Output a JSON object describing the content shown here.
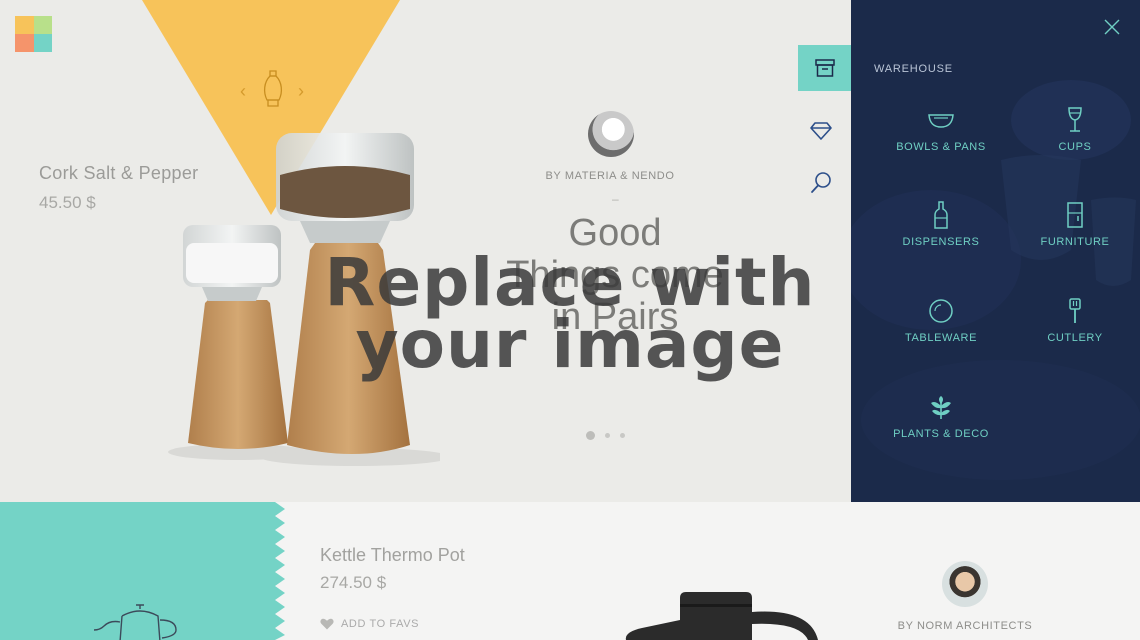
{
  "colors": {
    "hero_bg": "#ebebe8",
    "triangle": "#f7c35a",
    "teal": "#74d3c6",
    "panel": "#1b2a4a",
    "panel_label": "#6fcfc3",
    "logo": [
      "#f7c35a",
      "#b8e08a",
      "#f5946b",
      "#74d3c6"
    ]
  },
  "hero": {
    "product_name": "Cork Salt & Pepper",
    "product_price": "45.50 $",
    "byline": "BY MATERIA & NENDO",
    "dash": "–",
    "headline_line1": "Good",
    "headline_line2": "Things come",
    "headline_line3": "in Pairs",
    "placeholder_line1": "Replace with",
    "placeholder_line2": "your image",
    "prev_arrow": "‹",
    "next_arrow": "›",
    "slide_count": 3,
    "active_slide": 1
  },
  "side_icons": [
    "archive-icon",
    "diamond-icon",
    "search-icon"
  ],
  "panel": {
    "title": "WAREHOUSE",
    "close_icon": "close-icon",
    "categories": [
      {
        "label": "BOWLS & PANS",
        "icon": "bowl-icon"
      },
      {
        "label": "CUPS",
        "icon": "cup-icon"
      },
      {
        "label": "DISPENSERS",
        "icon": "bottle-icon"
      },
      {
        "label": "FURNITURE",
        "icon": "cabinet-icon"
      },
      {
        "label": "TABLEWARE",
        "icon": "plate-icon"
      },
      {
        "label": "CUTLERY",
        "icon": "spatula-icon"
      },
      {
        "label": "PLANTS & DECO",
        "icon": "plant-icon"
      }
    ]
  },
  "bottom": {
    "product_name": "Kettle Thermo Pot",
    "product_price": "274.50 $",
    "favs_label": "ADD TO FAVS",
    "byline": "BY NORM ARCHITECTS"
  }
}
